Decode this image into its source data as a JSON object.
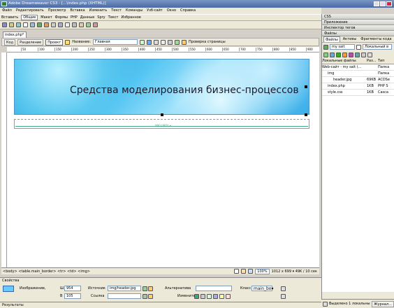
{
  "app": {
    "title": "Adobe Dreamweaver CS3 - [...\\index.php (XHTML)]"
  },
  "menu": [
    "Файл",
    "Редактировать",
    "Просмотр",
    "Вставка",
    "Изменить",
    "Текст",
    "Команды",
    "Узб-сайт",
    "Окно",
    "Справка"
  ],
  "insert_bar": {
    "label": "Вставить",
    "tabs": [
      "Общие",
      "Макет",
      "Формы",
      "PHP",
      "Данные",
      "Spry",
      "Текст",
      "Избранное"
    ]
  },
  "document": {
    "tab": "index.php*",
    "views": [
      "Код",
      "Разделение",
      "Проект"
    ],
    "title_label": "Название:",
    "title_value": "Главная",
    "check_page": "Проверка страницы"
  },
  "ruler": {
    "marks": [
      "50",
      "100",
      "150",
      "200",
      "250",
      "300",
      "350",
      "400",
      "450",
      "500",
      "550",
      "600",
      "650",
      "700",
      "750",
      "800",
      "850",
      "900"
    ]
  },
  "banner": {
    "heading": "Средства моделирования бизнес-процессов",
    "width_label": "990 (960) ▾"
  },
  "status": {
    "tags": "<body> <table.main_border> <tr> <td> <img>",
    "zoom": "100%",
    "size": "1012 x 699 ▾ 49K / 10 сек"
  },
  "properties": {
    "header": "Свойства",
    "image_label": "Изображение,",
    "w_label": "Ш",
    "w_value": "954",
    "h_label": "В",
    "h_value": "105",
    "src_label": "Источник",
    "src_value": "img/header.jpg",
    "link_label": "Ссылка",
    "alt_label": "Альтернатива",
    "class_label": "Класс",
    "class_value": "main_bo▾",
    "edit_label": "Изменить"
  },
  "results": {
    "label": "Результаты"
  },
  "right_panel": {
    "panels": [
      "CSS",
      "Приложение",
      "Инспектор тегов",
      "Файлы"
    ],
    "file_tabs": [
      "Файлы",
      "Активы",
      "Фрагменты кода"
    ],
    "site": "my sait",
    "view": "Локальный в",
    "columns": [
      "Локальные файлы",
      "Раз...",
      "Тип"
    ],
    "files": [
      {
        "name": "Web-сайт - my sait (...",
        "size": "",
        "type": "Папка"
      },
      {
        "name": "img",
        "size": "",
        "type": "Папка"
      },
      {
        "name": "header.jpg",
        "size": "69KB",
        "type": "ACDSe"
      },
      {
        "name": "index.php",
        "size": "1KB",
        "type": "PHP S"
      },
      {
        "name": "style.css",
        "size": "1KB",
        "type": "Casca"
      }
    ],
    "status_text": "Выделено 1 локальны: из",
    "log_button": "Журнал..."
  }
}
